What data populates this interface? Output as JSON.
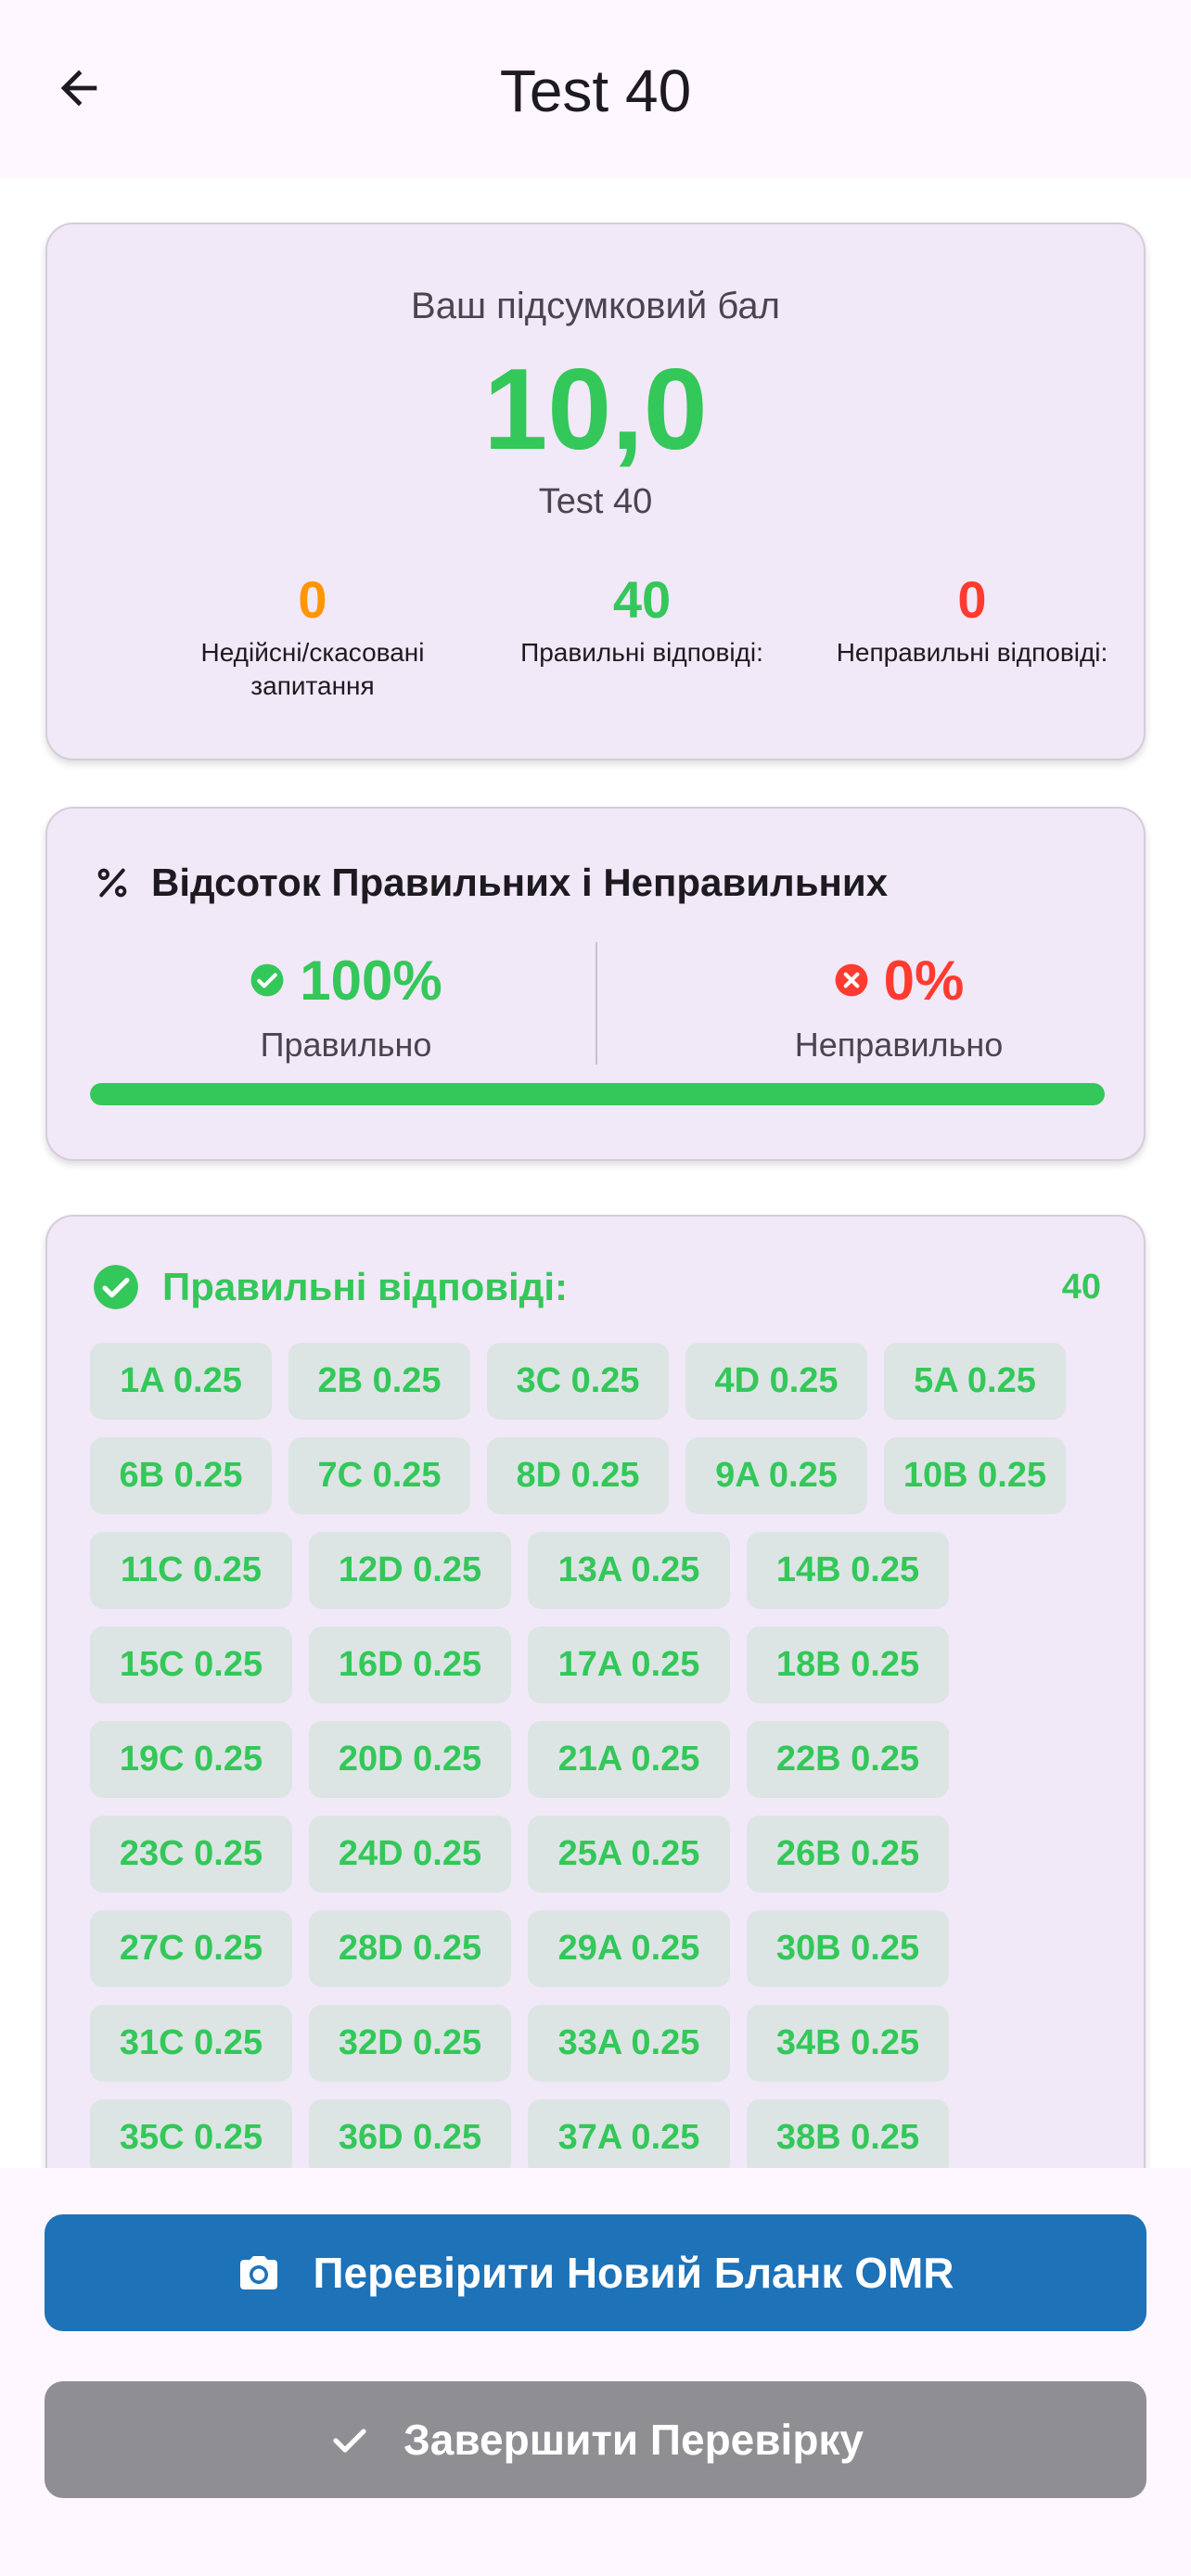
{
  "app_bar": {
    "title": "Test 40"
  },
  "score": {
    "label": "Ваш підсумковий бал",
    "value": "10,0",
    "test_name": "Test 40",
    "stats": [
      {
        "value": "0",
        "label": "Недійсні/скасовані запитання",
        "color": "#FF9500"
      },
      {
        "value": "40",
        "label": "Правильні відповіді:",
        "color": "#34C759"
      },
      {
        "value": "0",
        "label": "Неправильні відповіді:",
        "color": "#FF3B30"
      }
    ]
  },
  "percentage": {
    "title": "Відсоток Правильних і Неправильних",
    "correct_value": "100%",
    "correct_label": "Правильно",
    "wrong_value": "0%",
    "wrong_label": "Неправильно",
    "progress_fraction": 1.0
  },
  "answers": {
    "title": "Правильні відповіді:",
    "count": "40",
    "rows": [
      [
        "1A 0.25",
        "2B 0.25",
        "3C 0.25",
        "4D 0.25",
        "5A 0.25"
      ],
      [
        "6B 0.25",
        "7C 0.25",
        "8D 0.25",
        "9A 0.25",
        "10B 0.25"
      ],
      [
        "11C 0.25",
        "12D 0.25",
        "13A 0.25",
        "14B 0.25"
      ],
      [
        "15C 0.25",
        "16D 0.25",
        "17A 0.25",
        "18B 0.25"
      ],
      [
        "19C 0.25",
        "20D 0.25",
        "21A 0.25",
        "22B 0.25"
      ],
      [
        "23C 0.25",
        "24D 0.25",
        "25A 0.25",
        "26B 0.25"
      ],
      [
        "27C 0.25",
        "28D 0.25",
        "29A 0.25",
        "30B 0.25"
      ],
      [
        "31C 0.25",
        "32D 0.25",
        "33A 0.25",
        "34B 0.25"
      ],
      [
        "35C 0.25",
        "36D 0.25",
        "37A 0.25",
        "38B 0.25"
      ]
    ]
  },
  "actions": {
    "scan_label": "Перевірити Новий Бланк OMR",
    "finish_label": "Завершити Перевірку"
  },
  "colors": {
    "accent_green": "#34C759",
    "orange": "#FF9500",
    "red": "#FF3B30",
    "primary_blue": "#1D72B8",
    "gray_button": "#8E8E93"
  }
}
